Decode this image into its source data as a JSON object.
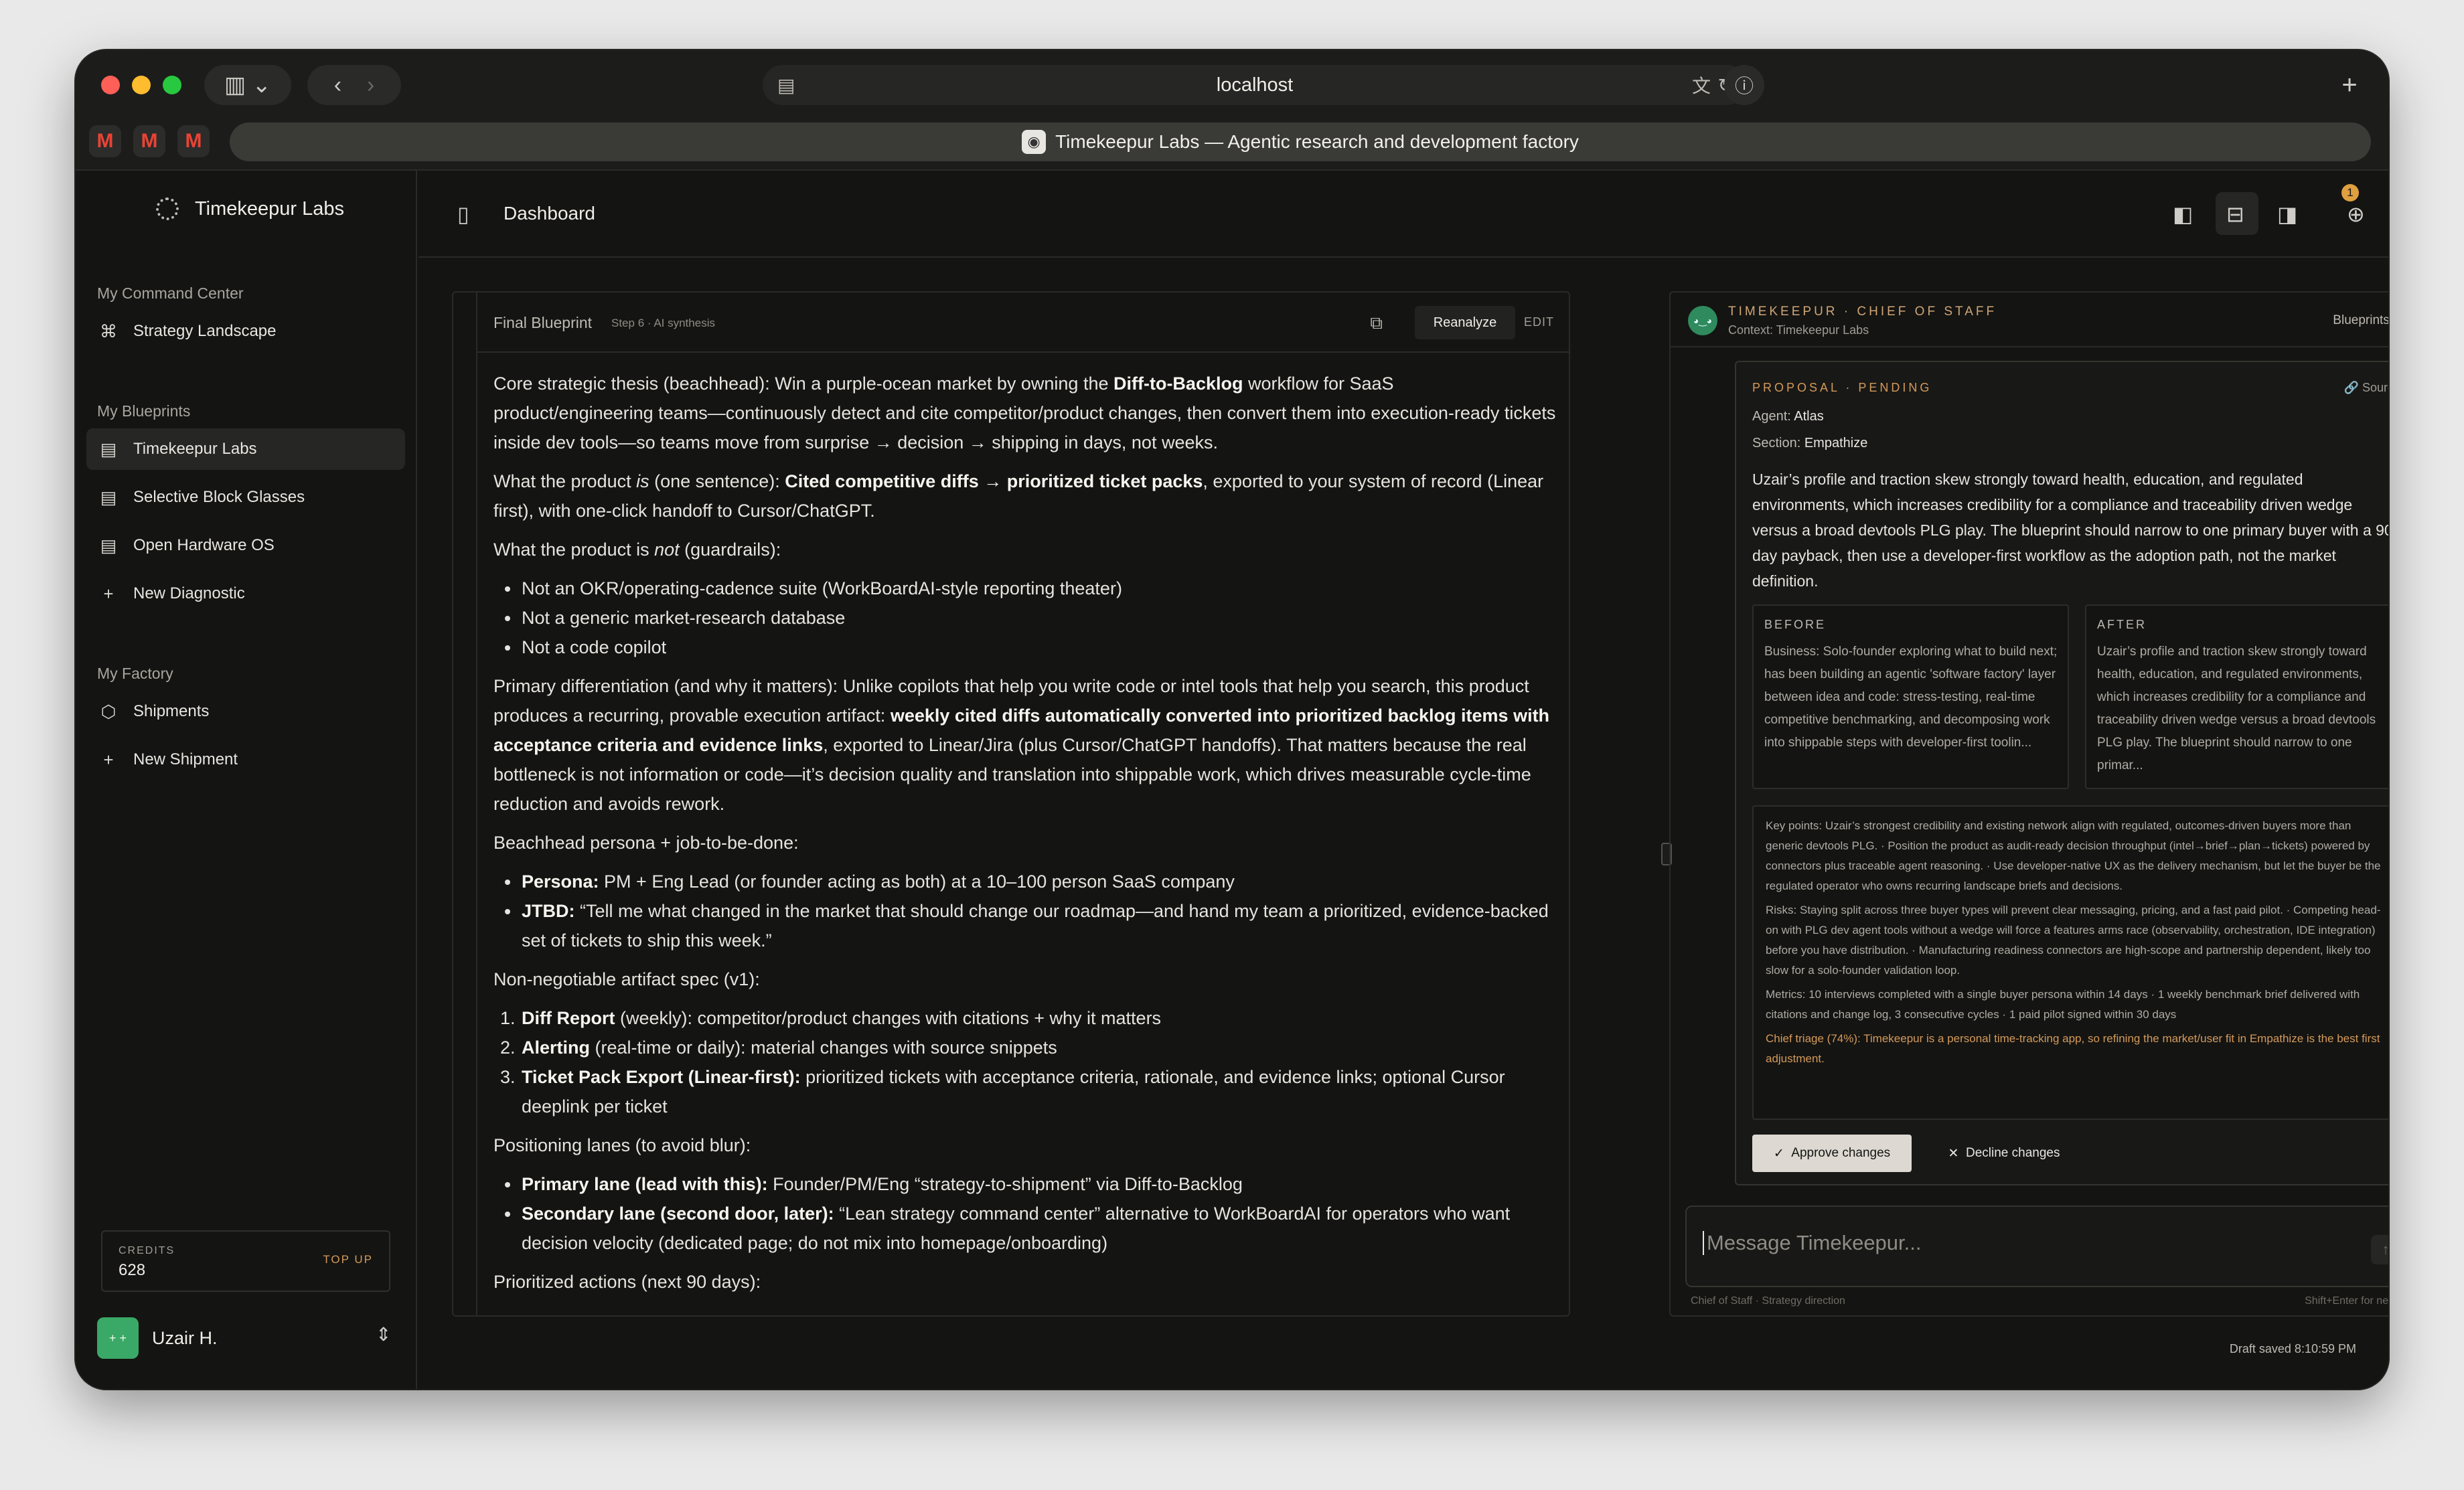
{
  "browser": {
    "url": "localhost",
    "tab_title": "Timekeepur Labs — Agentic research and development factory"
  },
  "sidebar": {
    "brand": "Timekeepur Labs",
    "sections": {
      "command": "My Command Center",
      "blueprints": "My Blueprints",
      "factory": "My Factory"
    },
    "command_items": [
      {
        "label": "Strategy Landscape",
        "icon": "command-icon"
      }
    ],
    "blueprint_items": [
      {
        "label": "Timekeepur Labs",
        "icon": "document-icon"
      },
      {
        "label": "Selective Block Glasses",
        "icon": "document-icon"
      },
      {
        "label": "Open Hardware OS",
        "icon": "document-icon"
      },
      {
        "label": "New Diagnostic",
        "icon": "plus-icon"
      }
    ],
    "factory_items": [
      {
        "label": "Shipments",
        "icon": "package-icon"
      },
      {
        "label": "New Shipment",
        "icon": "plus-icon"
      }
    ],
    "credits": {
      "label": "CREDITS",
      "value": "628",
      "action": "TOP UP"
    },
    "user": {
      "name": "Uzair H."
    }
  },
  "topbar": {
    "title": "Dashboard",
    "notification_count": "1"
  },
  "blueprint": {
    "title": "Final Blueprint",
    "subtitle": "Step 6 · AI synthesis",
    "reanalyze": "Reanalyze",
    "edit": "EDIT",
    "p1a": "Core strategic thesis (beachhead): Win a purple-ocean market by owning the ",
    "p1b": "Diff-to-Backlog",
    "p1c": " workflow for SaaS product/engineering teams—continuously detect and cite competitor/product changes, then convert them into execution-ready tickets inside dev tools—so teams move from surprise → decision → shipping in days, not weeks.",
    "p2a": "What the product ",
    "p2b": "is",
    "p2c": " (one sentence): ",
    "p2d": "Cited competitive diffs → prioritized ticket packs",
    "p2e": ", exported to your system of record (Linear first), with one-click handoff to Cursor/ChatGPT.",
    "p3a": "What the product is ",
    "p3b": "not",
    "p3c": " (guardrails):",
    "not_items": [
      "Not an OKR/operating-cadence suite (WorkBoardAI-style reporting theater)",
      "Not a generic market-research database",
      "Not a code copilot"
    ],
    "p4a": "Primary differentiation (and why it matters): Unlike copilots that help you write code or intel tools that help you search, this product produces a recurring, provable execution artifact: ",
    "p4b": "weekly cited diffs automatically converted into prioritized backlog items with acceptance criteria and evidence links",
    "p4c": ", exported to Linear/Jira (plus Cursor/ChatGPT handoffs). That matters because the real bottleneck is not information or code—it’s decision quality and translation into shippable work, which drives measurable cycle-time reduction and avoids rework.",
    "p5": "Beachhead persona + job-to-be-done:",
    "persona_label": "Persona:",
    "persona_text": " PM + Eng Lead (or founder acting as both) at a 10–100 person SaaS company",
    "jtbd_label": "JTBD:",
    "jtbd_text": " “Tell me what changed in the market that should change our roadmap—and hand my team a prioritized, evidence-backed set of tickets to ship this week.”",
    "p6": "Non-negotiable artifact spec (v1):",
    "spec": [
      {
        "b": "Diff Report",
        "t": " (weekly): competitor/product changes with citations + why it matters"
      },
      {
        "b": "Alerting",
        "t": " (real-time or daily): material changes with source snippets"
      },
      {
        "b": "Ticket Pack Export (Linear-first):",
        "t": " prioritized tickets with acceptance criteria, rationale, and evidence links; optional Cursor deeplink per ticket"
      }
    ],
    "p7": "Positioning lanes (to avoid blur):",
    "lanes": [
      {
        "b": "Primary lane (lead with this):",
        "t": " Founder/PM/Eng “strategy-to-shipment” via Diff-to-Backlog"
      },
      {
        "b": "Secondary lane (second door, later):",
        "t": " “Lean strategy command center” alternative to WorkBoardAI for operators who want decision velocity (dedicated page; do not mix into homepage/onboarding)"
      }
    ],
    "p8": "Prioritized actions (next 90 days):"
  },
  "chief": {
    "title": "TIMEKEEPUR · CHIEF OF STAFF",
    "context": "Context: Timekeepur Labs",
    "dropdown": "Blueprints",
    "proposal": {
      "tag": "PROPOSAL · PENDING",
      "source": "Source",
      "agent_label": "Agent: ",
      "agent": "Atlas",
      "section_label": "Section: ",
      "section": "Empathize",
      "text": "Uzair’s profile and traction skew strongly toward health, education, and regulated environments, which increases credibility for a compliance and traceability driven wedge versus a broad devtools PLG play. The blueprint should narrow to one primary buyer with a 90 day payback, then use a developer-first workflow as the adoption path, not the market definition.",
      "before_label": "BEFORE",
      "before": "Business: Solo-founder exploring what to build next; has been building an agentic 'software factory' layer between idea and code: stress-testing, real-time competitive benchmarking, and decomposing work into shippable steps with developer-first toolin...",
      "after_label": "AFTER",
      "after": "Uzair’s profile and traction skew strongly toward health, education, and regulated environments, which increases credibility for a compliance and traceability driven wedge versus a broad devtools PLG play. The blueprint should narrow to one primar...",
      "key_points": "Key points: Uzair’s strongest credibility and existing network align with regulated, outcomes-driven buyers more than generic devtools PLG. · Position the product as audit-ready decision throughput (intel→brief→plan→tickets) powered by connectors plus traceable agent reasoning. · Use developer-native UX as the delivery mechanism, but let the buyer be the regulated operator who owns recurring landscape briefs and decisions.",
      "risks": "Risks: Staying split across three buyer types will prevent clear messaging, pricing, and a fast paid pilot. · Competing head-on with PLG dev agent tools without a wedge will force a features arms race (observability, orchestration, IDE integration) before you have distribution. · Manufacturing readiness connectors are high-scope and partnership dependent, likely too slow for a solo-founder validation loop.",
      "metrics": "Metrics: 10 interviews completed with a single buyer persona within 14 days · 1 weekly benchmark brief delivered with citations and change log, 3 consecutive cycles · 1 paid pilot signed within 30 days",
      "triage": "Chief triage (74%): Timekeepur is a personal time-tracking app, so refining the market/user fit in Empathize is the best first adjustment.",
      "approve": "Approve changes",
      "decline": "Decline changes"
    },
    "input_placeholder": "Message Timekeepur...",
    "footer_left": "Chief of Staff · Strategy direction",
    "footer_right": "Shift+Enter for new line"
  },
  "status": {
    "draft": "Draft saved 8:10:59 PM"
  },
  "colors": {
    "accent": "#d49a5a",
    "background": "#141412",
    "avatar": "#3aa866"
  }
}
